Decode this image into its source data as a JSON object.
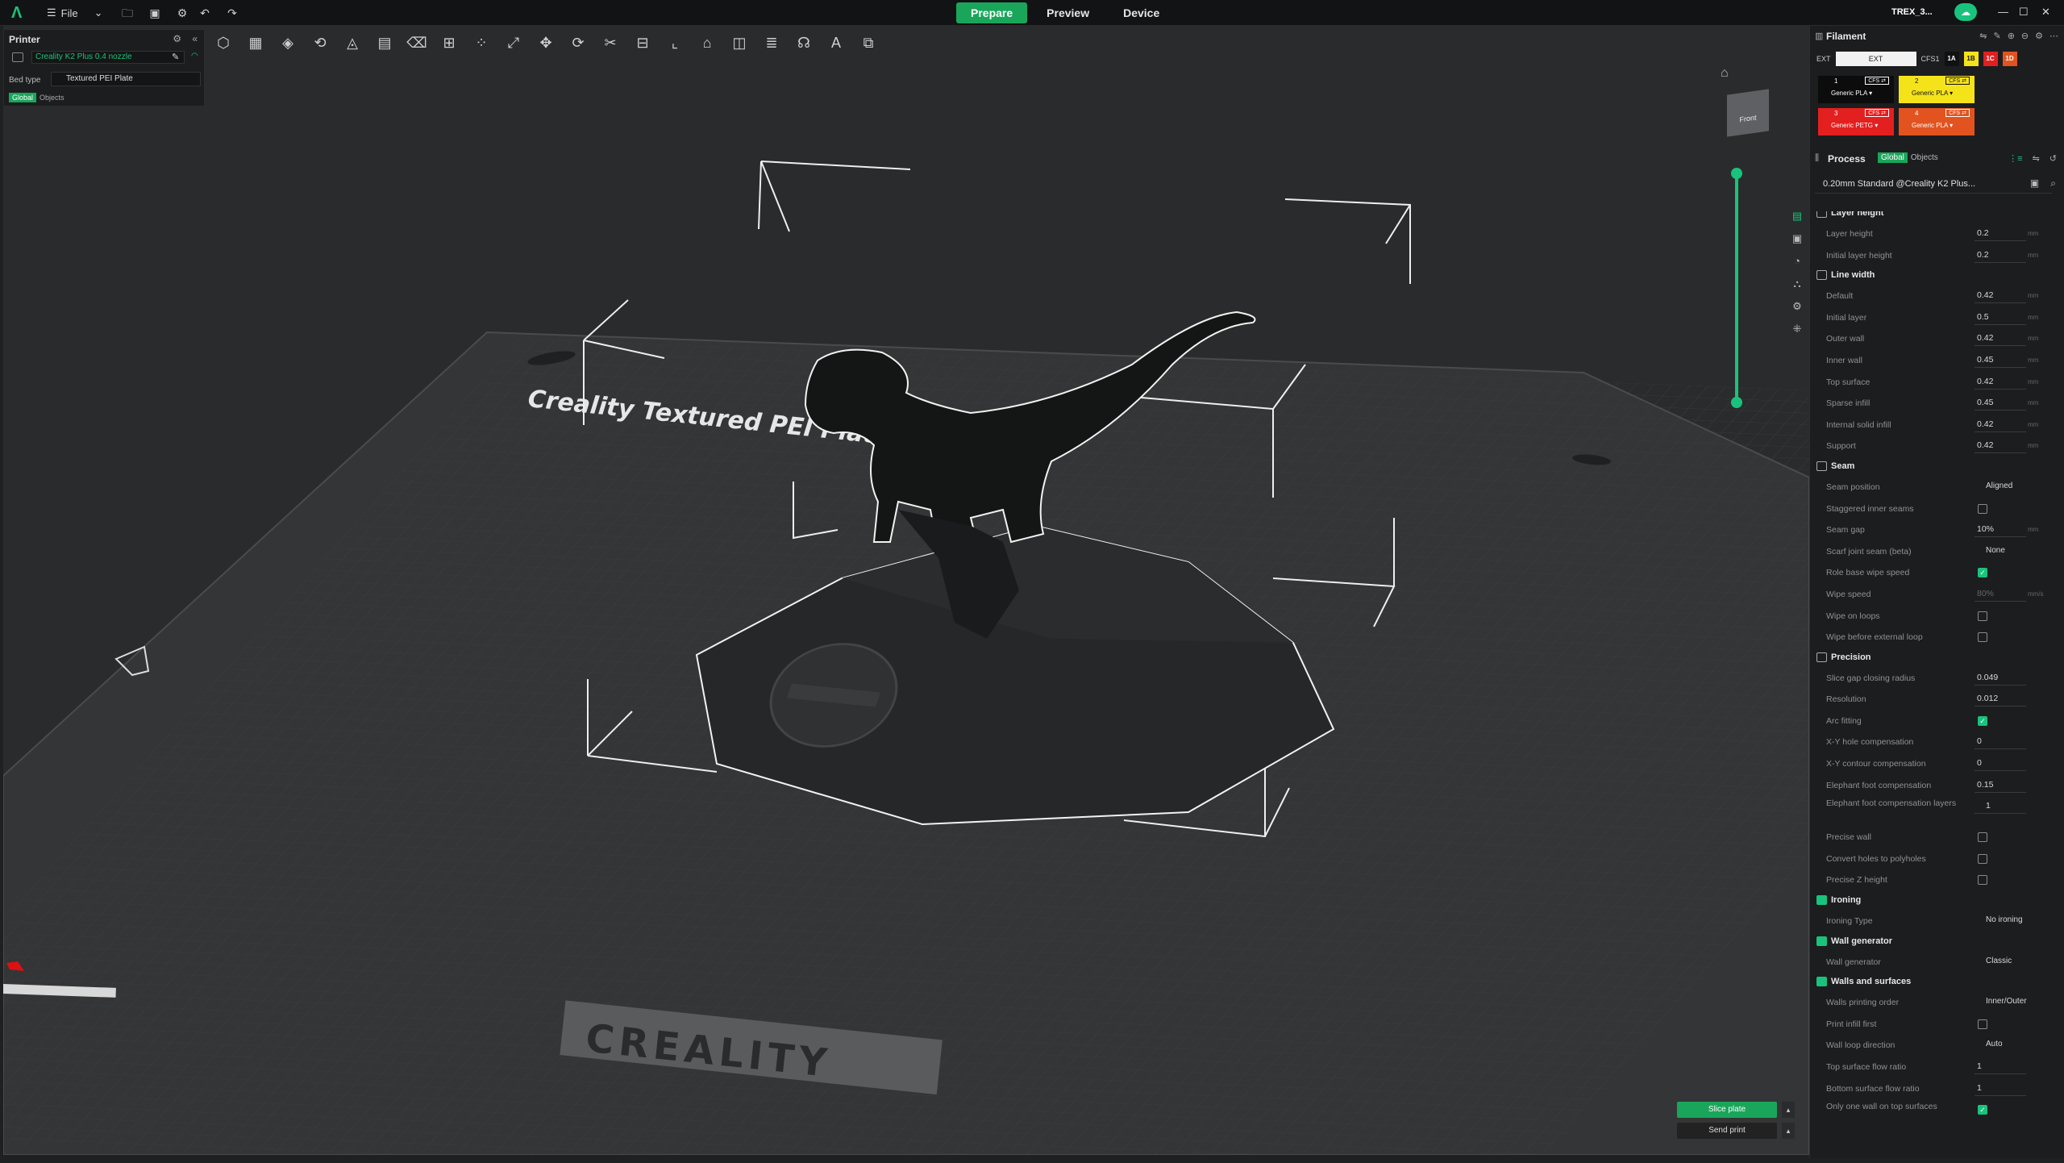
{
  "topbar": {
    "file_label": "File",
    "modes": [
      {
        "label": "Prepare",
        "active": true
      },
      {
        "label": "Preview",
        "active": false
      },
      {
        "label": "Device",
        "active": false
      }
    ],
    "window_title": "TREX_3..."
  },
  "printer_panel": {
    "title": "Printer",
    "printer_name": "Creality K2 Plus 0.4 nozzle",
    "bed_type_label": "Bed type",
    "bed_type_value": "Textured PEI Plate",
    "tabs": [
      "Global",
      "Objects"
    ]
  },
  "viewport": {
    "plate_text": "Creality Textured PEI Plate",
    "brand_text": "CREALITY",
    "viewcube_label": "Front"
  },
  "filament": {
    "title": "Filament",
    "ext_label": "EXT",
    "ext_value": "EXT",
    "cfs_label": "CFS1",
    "slot_tags": [
      {
        "label": "1A",
        "bg": "#111111",
        "fg": "#ffffff"
      },
      {
        "label": "1B",
        "bg": "#f5e31a",
        "fg": "#111111"
      },
      {
        "label": "1C",
        "bg": "#e02020",
        "fg": "#ffffff"
      },
      {
        "label": "1D",
        "bg": "#e2531f",
        "fg": "#ffffff"
      }
    ],
    "slots": [
      {
        "num": "1",
        "cfs": "CFS ⇄",
        "name": "Generic PLA ▾",
        "bg": "#0c0c0c",
        "fg": "#ffffff"
      },
      {
        "num": "2",
        "cfs": "CFS ⇄",
        "name": "Generic PLA ▾",
        "bg": "#f5e31a",
        "fg": "#111111"
      },
      {
        "num": "3",
        "cfs": "CFS ⇄",
        "name": "Generic PETG ▾",
        "bg": "#e41f1f",
        "fg": "#ffffff"
      },
      {
        "num": "4",
        "cfs": "CFS ⇄",
        "name": "Generic PLA ▾",
        "bg": "#e2531f",
        "fg": "#ffffff"
      }
    ]
  },
  "process": {
    "title": "Process",
    "tabs": [
      "Global",
      "Objects"
    ],
    "preset": "0.20mm Standard @Creality K2 Plus..."
  },
  "settings": {
    "layer_height": {
      "title": "Layer height",
      "rows": [
        {
          "label": "Layer height",
          "value": "0.2",
          "unit": "mm"
        },
        {
          "label": "Initial layer height",
          "value": "0.2",
          "unit": "mm"
        }
      ]
    },
    "line_width": {
      "title": "Line width",
      "rows": [
        {
          "label": "Default",
          "value": "0.42",
          "unit": "mm"
        },
        {
          "label": "Initial layer",
          "value": "0.5",
          "unit": "mm"
        },
        {
          "label": "Outer wall",
          "value": "0.42",
          "unit": "mm"
        },
        {
          "label": "Inner wall",
          "value": "0.45",
          "unit": "mm"
        },
        {
          "label": "Top surface",
          "value": "0.42",
          "unit": "mm"
        },
        {
          "label": "Sparse infill",
          "value": "0.45",
          "unit": "mm"
        },
        {
          "label": "Internal solid infill",
          "value": "0.42",
          "unit": "mm"
        },
        {
          "label": "Support",
          "value": "0.42",
          "unit": "mm"
        }
      ]
    },
    "seam": {
      "title": "Seam",
      "rows": [
        {
          "label": "Seam position",
          "dropdown": "Aligned"
        },
        {
          "label": "Staggered inner seams",
          "checked": false
        },
        {
          "label": "Seam gap",
          "value": "10%",
          "unit": "mm"
        },
        {
          "label": "Scarf joint seam (beta)",
          "dropdown": "None"
        },
        {
          "label": "Role base wipe speed",
          "checked": true
        },
        {
          "label": "Wipe speed",
          "value": "80%",
          "unit": "mm/s"
        },
        {
          "label": "Wipe on loops",
          "checked": false
        },
        {
          "label": "Wipe before external loop",
          "checked": false
        }
      ]
    },
    "precision": {
      "title": "Precision",
      "rows": [
        {
          "label": "Slice gap closing radius",
          "value": "0.049"
        },
        {
          "label": "Resolution",
          "value": "0.012"
        },
        {
          "label": "Arc fitting",
          "checked": true
        },
        {
          "label": "X-Y hole compensation",
          "value": "0"
        },
        {
          "label": "X-Y contour compensation",
          "value": "0"
        },
        {
          "label": "Elephant foot compensation",
          "value": "0.15"
        },
        {
          "label": "Elephant foot compensation layers",
          "value": "1"
        },
        {
          "label": "Precise wall",
          "checked": false
        },
        {
          "label": "Convert holes to polyholes",
          "checked": false
        },
        {
          "label": "Precise Z height",
          "checked": false
        }
      ]
    },
    "ironing": {
      "title": "Ironing",
      "rows": [
        {
          "label": "Ironing Type",
          "dropdown": "No ironing"
        }
      ]
    },
    "wall_generator": {
      "title": "Wall generator",
      "rows": [
        {
          "label": "Wall generator",
          "dropdown": "Classic"
        }
      ]
    },
    "walls_surfaces": {
      "title": "Walls and surfaces",
      "rows": [
        {
          "label": "Walls printing order",
          "dropdown": "Inner/Outer"
        },
        {
          "label": "Print infill first",
          "checked": false
        },
        {
          "label": "Wall loop direction",
          "dropdown": "Auto"
        },
        {
          "label": "Top surface flow ratio",
          "value": "1"
        },
        {
          "label": "Bottom surface flow ratio",
          "value": "1"
        },
        {
          "label": "Only one wall on top surfaces",
          "checked": true
        }
      ]
    }
  },
  "actions": {
    "slice_label": "Slice plate",
    "send_label": "Send print"
  },
  "colors": {
    "accent": "#19c37d",
    "accent_dark": "#19a65a",
    "bg": "#1c1d1f"
  }
}
